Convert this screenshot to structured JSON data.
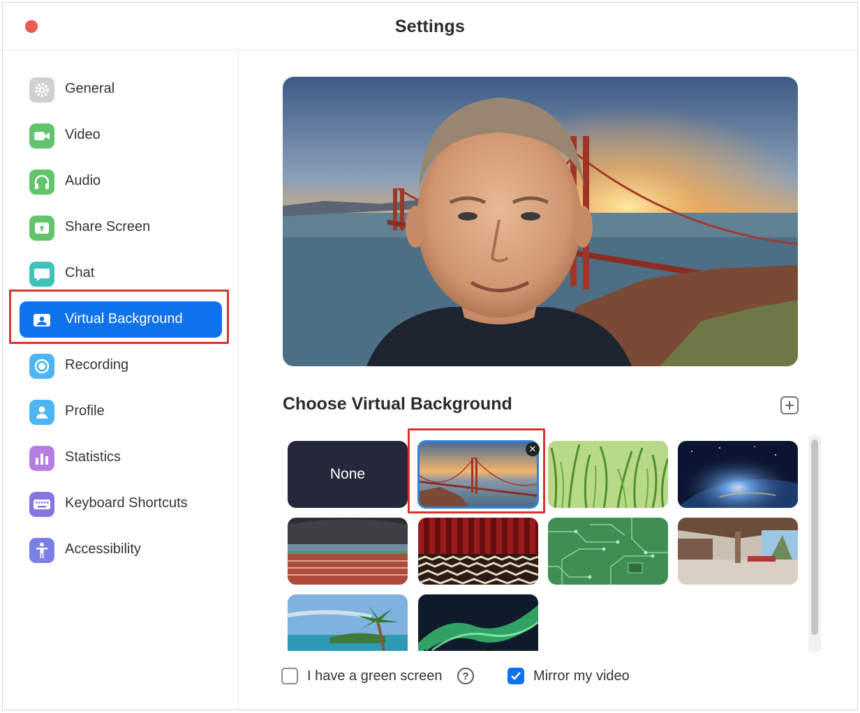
{
  "window": {
    "title": "Settings"
  },
  "sidebar": {
    "items": [
      {
        "label": "General",
        "icon": "gear-icon",
        "color": "#c8c8c8"
      },
      {
        "label": "Video",
        "icon": "video-camera-icon",
        "color": "#5cc468"
      },
      {
        "label": "Audio",
        "icon": "headphones-icon",
        "color": "#5cc468"
      },
      {
        "label": "Share Screen",
        "icon": "share-screen-icon",
        "color": "#5cc468"
      },
      {
        "label": "Chat",
        "icon": "chat-bubble-icon",
        "color": "#3fc3b9"
      },
      {
        "label": "Virtual Background",
        "icon": "person-card-icon",
        "color": "#0e72ed",
        "active": true
      },
      {
        "label": "Recording",
        "icon": "record-icon",
        "color": "#4db5f2"
      },
      {
        "label": "Profile",
        "icon": "person-icon",
        "color": "#4db5f2"
      },
      {
        "label": "Statistics",
        "icon": "bar-chart-icon",
        "color": "#b77ee2"
      },
      {
        "label": "Keyboard Shortcuts",
        "icon": "keyboard-icon",
        "color": "#8c74e0"
      },
      {
        "label": "Accessibility",
        "icon": "accessibility-icon",
        "color": "#7b7fe6"
      }
    ]
  },
  "main": {
    "section_title": "Choose Virtual Background",
    "backgrounds": [
      {
        "label": "None",
        "scene": "none"
      },
      {
        "label": "",
        "scene": "golden-gate-bridge",
        "selected": true
      },
      {
        "label": "",
        "scene": "grass"
      },
      {
        "label": "",
        "scene": "earth-from-space"
      },
      {
        "label": "",
        "scene": "running-track"
      },
      {
        "label": "",
        "scene": "red-curtain-room"
      },
      {
        "label": "",
        "scene": "circuit-board"
      },
      {
        "label": "",
        "scene": "lobby"
      },
      {
        "label": "",
        "scene": "tropical-beach"
      },
      {
        "label": "",
        "scene": "aurora"
      }
    ],
    "green_screen_label": "I have a green screen",
    "green_screen_checked": false,
    "mirror_label": "Mirror my video",
    "mirror_checked": true
  },
  "colors": {
    "accent": "#0e72ed",
    "highlight_border": "#d9342b"
  }
}
